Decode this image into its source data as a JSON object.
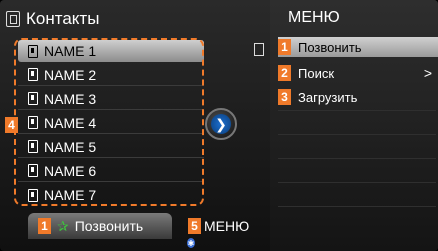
{
  "title": "Контакты",
  "contacts": [
    {
      "label": "NAME 1"
    },
    {
      "label": "NAME 2"
    },
    {
      "label": "NAME 3"
    },
    {
      "label": "NAME 4"
    },
    {
      "label": "NAME 5"
    },
    {
      "label": "NAME 6"
    },
    {
      "label": "NAME 7"
    }
  ],
  "menu": {
    "header": "МЕНЮ",
    "items": [
      {
        "badge": "1",
        "label": "Позвонить",
        "selected": true
      },
      {
        "badge": "2",
        "label": "Поиск",
        "arrow": ">"
      },
      {
        "badge": "3",
        "label": "Загрузить"
      }
    ]
  },
  "list_badge": "4",
  "bottom": {
    "call_badge": "1",
    "call_label": "Позвонить",
    "menu_badge": "5",
    "menu_label": "МЕНЮ"
  },
  "colors": {
    "accent": "#f07a2a",
    "selection": "#c8c8c8",
    "knob": "#1c6fd0"
  },
  "icons": {
    "title": "contacts-card-icon",
    "contact": "contact-card-icon",
    "call": "phone-icon",
    "scroll": "scroll-knob-icon",
    "bluetooth": "bluetooth-icon"
  }
}
